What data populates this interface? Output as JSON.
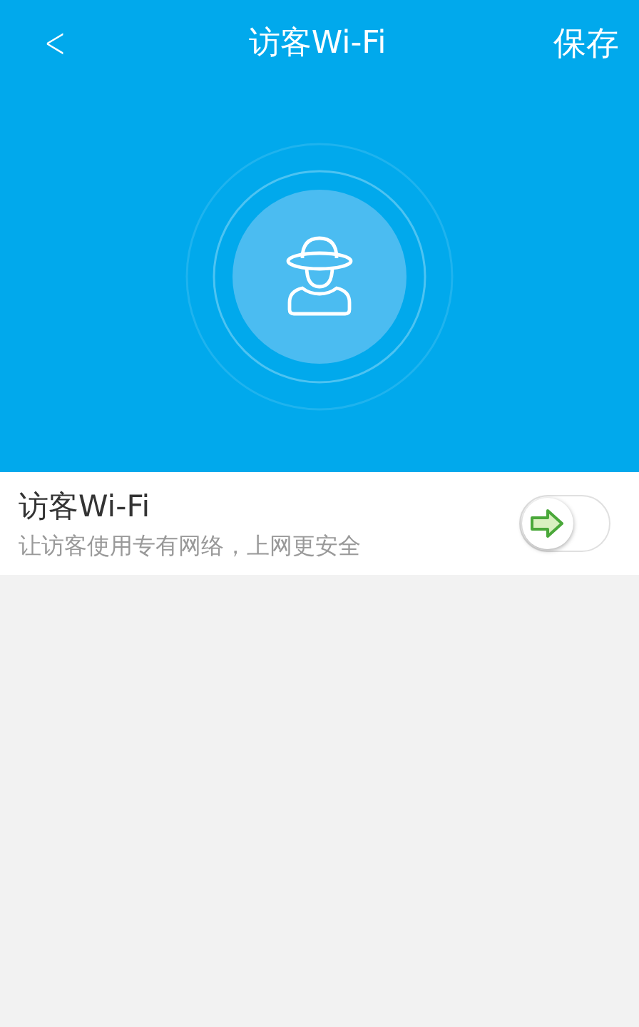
{
  "header": {
    "back": "<",
    "title": "访客Wi-Fi",
    "action": "保存"
  },
  "setting": {
    "title": "访客Wi-Fi",
    "subtitle": "让访客使用专有网络，上网更安全",
    "on": false
  }
}
